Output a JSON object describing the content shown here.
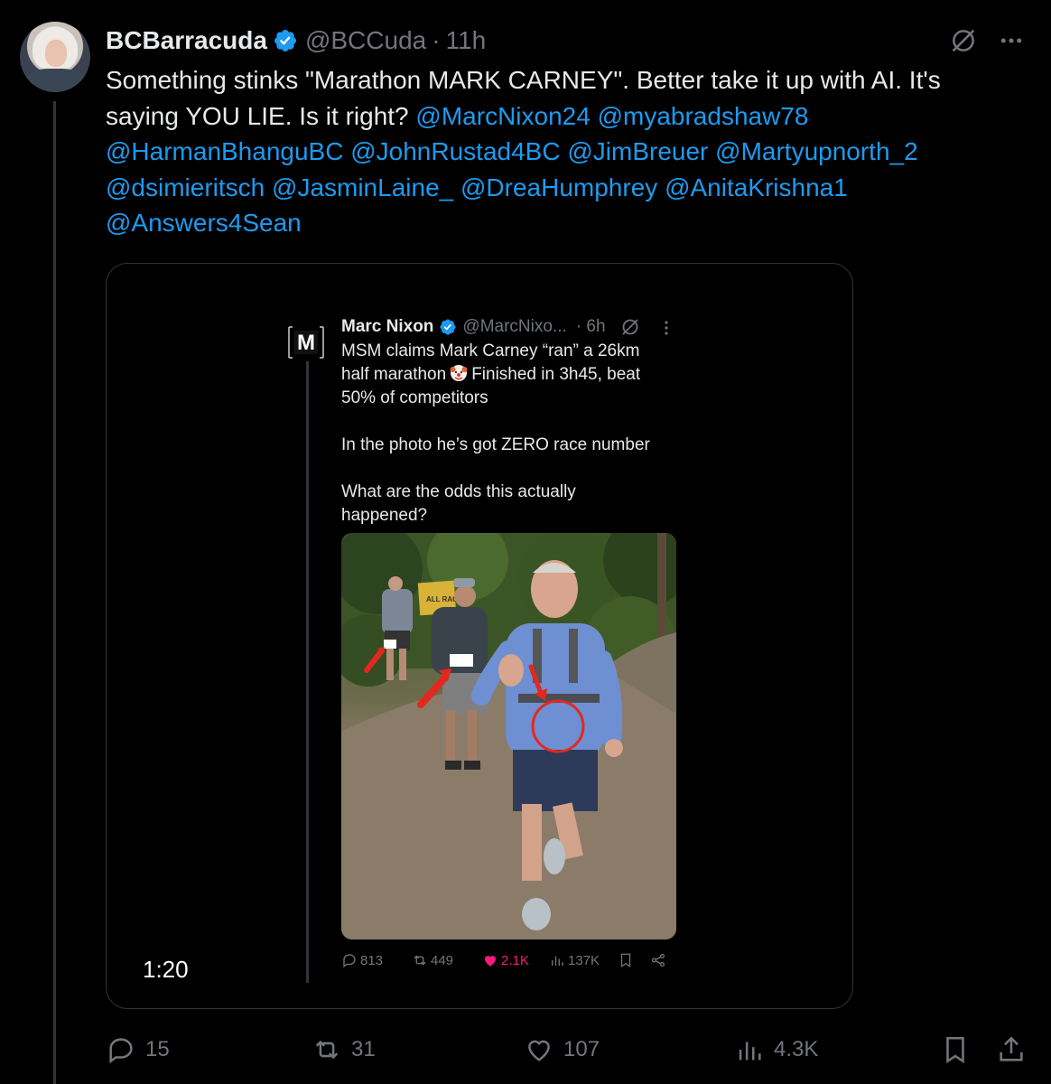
{
  "author": {
    "name": "BCBarracuda",
    "handle": "@BCCuda",
    "separator": "·",
    "time": "11h"
  },
  "tweet": {
    "text": "Something stinks \"Marathon MARK CARNEY\". Better take it up with AI. It's saying YOU LIE. Is it right?",
    "mentions": [
      "@MarcNixon24",
      "@myabradshaw78",
      "@HarmanBhanguBC",
      "@JohnRustad4BC",
      "@JimBreuer",
      "@Martyupnorth_2",
      "@dsimieritsch",
      "@JasminLaine_",
      "@DreaHumphrey",
      "@AnitaKrishna1",
      "@Answers4Sean"
    ]
  },
  "media": {
    "duration": "1:20",
    "inner_tweet": {
      "logo_letter": "M",
      "name": "Marc Nixon",
      "handle": "@MarcNixo...",
      "time": "· 6h",
      "text_line1_a": "MSM claims Mark Carney “ran” a 26km",
      "text_line2_a": "half marathon",
      "text_line2_b": "Finished in 3h45, beat",
      "text_line3": "50% of competitors",
      "text_para2": "In the photo he’s got ZERO race number",
      "text_para3": "What are the odds this actually\nhappened?",
      "photo_sign_text": "ALL RACES",
      "actions": {
        "replies": "813",
        "reposts": "449",
        "likes": "2.1K",
        "views": "137K"
      }
    }
  },
  "actions": {
    "replies": "15",
    "reposts": "31",
    "likes": "107",
    "views": "4.3K"
  },
  "colors": {
    "background": "#000000",
    "text": "#e7e9ea",
    "muted": "#71767b",
    "link": "#1d9bf0",
    "like": "#f91880",
    "border": "#2f3336"
  }
}
